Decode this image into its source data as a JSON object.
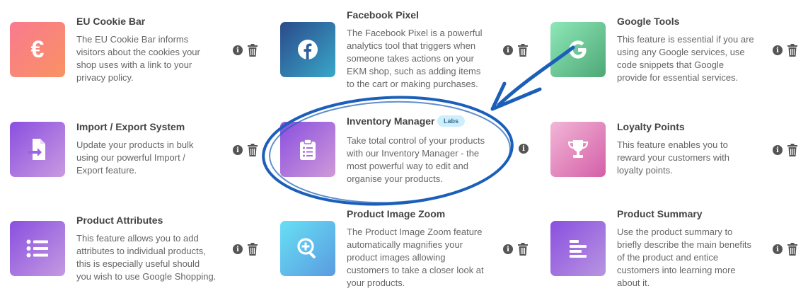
{
  "features": [
    {
      "key": "eu-cookie-bar",
      "title": "EU Cookie Bar",
      "icon": "euro-icon",
      "desc": [
        "The EU Cookie Bar informs",
        "visitors about the cookies your",
        "shop uses with a link to your",
        "privacy policy."
      ]
    },
    {
      "key": "facebook-pixel",
      "title": "Facebook Pixel",
      "icon": "facebook-icon",
      "desc": [
        "The Facebook Pixel is a powerful",
        "analytics tool that triggers when",
        "someone takes actions on your",
        "EKM shop, such as adding items",
        "to the cart or making purchases."
      ]
    },
    {
      "key": "google-tools",
      "title": "Google Tools",
      "icon": "google-icon",
      "desc": [
        "This feature is essential if you are",
        "using any Google services, use",
        "code snippets that Google",
        "provide for essential services."
      ]
    },
    {
      "key": "import-export",
      "title": "Import / Export System",
      "icon": "file-import-icon",
      "desc": [
        "Update your products in bulk",
        "using our powerful Import /",
        "Export feature."
      ]
    },
    {
      "key": "inventory-manager",
      "title": "Inventory Manager",
      "badge": "Labs",
      "icon": "clipboard-icon",
      "desc": [
        "Take total control of your products",
        "with our Inventory Manager - the",
        "most powerful way to edit and",
        "organise your products."
      ]
    },
    {
      "key": "loyalty-points",
      "title": "Loyalty Points",
      "icon": "trophy-icon",
      "desc": [
        "This feature enables you to",
        "reward your customers with",
        "loyalty points."
      ]
    },
    {
      "key": "product-attributes",
      "title": "Product Attributes",
      "icon": "list-icon",
      "desc": [
        "This feature allows you to add",
        "attributes to individual products,",
        "this is especially useful should",
        "you wish to use Google Shopping."
      ]
    },
    {
      "key": "product-image-zoom",
      "title": "Product Image Zoom",
      "icon": "zoom-in-icon",
      "desc": [
        "The Product Image Zoom feature",
        "automatically magnifies your",
        "product images allowing",
        "customers to take a closer look at",
        "your products."
      ]
    },
    {
      "key": "product-summary",
      "title": "Product Summary",
      "icon": "align-left-icon",
      "desc": [
        "Use the product summary to",
        "briefly describe the main benefits",
        "of the product and entice",
        "customers into learning more",
        "about it."
      ]
    }
  ],
  "glyphs": {
    "euro": "€",
    "info": "i"
  },
  "colors": {
    "annotation": "#1b5fb8",
    "euro_gradient": [
      "#f97a8f",
      "#f99262"
    ],
    "facebook_gradient": [
      "#2a4a8a",
      "#39a7c9"
    ],
    "google_gradient": [
      "#8ee7b7",
      "#4ea876"
    ],
    "import_gradient": [
      "#8a4fe0",
      "#c99be0"
    ],
    "inventory_gradient": [
      "#8a4fe0",
      "#d09ad8"
    ],
    "loyalty_gradient": [
      "#f2b6d6",
      "#d45fa8"
    ],
    "attributes_gradient": [
      "#8a4fe0",
      "#c49ae0"
    ],
    "zoom_gradient": [
      "#67e0f5",
      "#5a9be0"
    ],
    "summary_gradient": [
      "#8a4fe0",
      "#b895e0"
    ]
  }
}
